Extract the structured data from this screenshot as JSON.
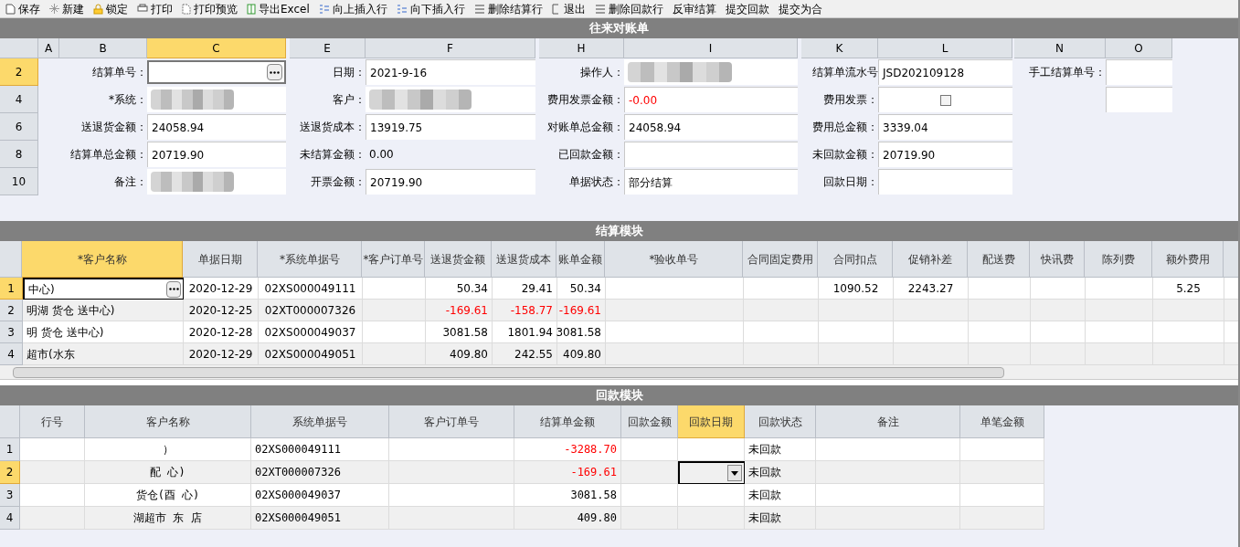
{
  "toolbar": [
    {
      "label": "保存"
    },
    {
      "label": "新建"
    },
    {
      "label": "锁定"
    },
    {
      "label": "打印"
    },
    {
      "label": "打印预览"
    },
    {
      "label": "导出Excel"
    },
    {
      "label": "向上插入行"
    },
    {
      "label": "向下插入行"
    },
    {
      "label": "删除结算行"
    },
    {
      "label": "退出"
    },
    {
      "label": "删除回款行"
    },
    {
      "label": "反审结算"
    },
    {
      "label": "提交回款"
    },
    {
      "label": "提交为合"
    }
  ],
  "statement": {
    "title": "往来对账单",
    "columns": [
      {
        "label": "A",
        "selected": false
      },
      {
        "label": "B",
        "selected": false
      },
      {
        "label": "C",
        "selected": true
      },
      {
        "label": "E",
        "selected": false
      },
      {
        "label": "F",
        "selected": false
      },
      {
        "label": "H",
        "selected": false
      },
      {
        "label": "I",
        "selected": false
      },
      {
        "label": "K",
        "selected": false
      },
      {
        "label": "L",
        "selected": false
      },
      {
        "label": "N",
        "selected": false
      },
      {
        "label": "O",
        "selected": false
      }
    ],
    "rows": [
      {
        "number": "2",
        "selected": true,
        "fields": [
          {
            "label": "结算单号：",
            "kind": "lookup",
            "selected": true
          },
          {
            "label": "日期：",
            "kind": "text",
            "value": "2021-9-16"
          },
          {
            "label": "操作人：",
            "kind": "redacted"
          },
          {
            "label": "结算单流水号",
            "kind": "text",
            "value": "JSD202109128"
          },
          {
            "label": "手工结算单号：",
            "kind": "text"
          }
        ]
      },
      {
        "number": "4",
        "selected": false,
        "fields": [
          {
            "label": "*系统：",
            "kind": "redacted"
          },
          {
            "label": "客户：",
            "kind": "redacted"
          },
          {
            "label": "费用发票金额：",
            "kind": "text",
            "value": "-0.00",
            "negative": true
          },
          {
            "label": "费用发票：",
            "kind": "checkbox",
            "checked": false
          },
          {
            "kind": "text"
          }
        ]
      },
      {
        "number": "6",
        "selected": false,
        "fields": [
          {
            "label": "送退货金额：",
            "kind": "text",
            "value": "24058.94"
          },
          {
            "label": "送退货成本：",
            "kind": "text",
            "value": "13919.75"
          },
          {
            "label": "对账单总金额：",
            "kind": "text",
            "value": "24058.94"
          },
          {
            "label": "费用总金额：",
            "kind": "text",
            "value": "3339.04"
          }
        ]
      },
      {
        "number": "8",
        "selected": false,
        "fields": [
          {
            "label": "结算单总金额：",
            "kind": "text",
            "value": "20719.90"
          },
          {
            "label": "未结算金额：",
            "kind": "plain",
            "value": "0.00"
          },
          {
            "label": "已回款金额：",
            "kind": "text"
          },
          {
            "label": "未回款金额：",
            "kind": "text",
            "value": "20719.90"
          }
        ]
      },
      {
        "number": "10",
        "selected": false,
        "fields": [
          {
            "label": "备注：",
            "kind": "redacted"
          },
          {
            "label": "开票金额：",
            "kind": "text",
            "value": "20719.90"
          },
          {
            "label": "单据状态：",
            "kind": "text",
            "value": "部分结算"
          },
          {
            "label": "回款日期：",
            "kind": "text"
          }
        ]
      }
    ]
  },
  "settlement": {
    "title": "结算模块",
    "columns": [
      {
        "label": "*客户名称",
        "selected": true
      },
      {
        "label": "单据日期",
        "selected": false
      },
      {
        "label": "*系统单据号",
        "selected": false
      },
      {
        "label": "*客户订单号",
        "selected": false
      },
      {
        "label": "送退货金额",
        "selected": false
      },
      {
        "label": "送退货成本",
        "selected": false
      },
      {
        "label": "账单金额",
        "selected": false
      },
      {
        "label": "*验收单号",
        "selected": false
      },
      {
        "label": "合同固定费用",
        "selected": false
      },
      {
        "label": "合同扣点",
        "selected": false
      },
      {
        "label": "促销补差",
        "selected": false
      },
      {
        "label": "配送费",
        "selected": false
      },
      {
        "label": "快讯费",
        "selected": false
      },
      {
        "label": "陈列费",
        "selected": false
      },
      {
        "label": "额外费用",
        "selected": false
      }
    ],
    "rows": [
      {
        "number": "1",
        "selected": true,
        "negative": false,
        "cells": [
          "中心)",
          "2020-12-29",
          "02XS000049111",
          "",
          "50.34",
          "29.41",
          "50.34",
          "",
          "",
          "1090.52",
          "2243.27",
          "",
          "",
          "",
          "5.25"
        ]
      },
      {
        "number": "2",
        "selected": false,
        "negative": true,
        "cells": [
          "明湖 货仓 送中心)",
          "2020-12-25",
          "02XT000007326",
          "",
          "-169.61",
          "-158.77",
          "-169.61",
          "",
          "",
          "",
          "",
          "",
          "",
          "",
          ""
        ]
      },
      {
        "number": "3",
        "selected": false,
        "negative": false,
        "cells": [
          "明 货仓 送中心)",
          "2020-12-28",
          "02XS000049037",
          "",
          "3081.58",
          "1801.94",
          "3081.58",
          "",
          "",
          "",
          "",
          "",
          "",
          "",
          ""
        ]
      },
      {
        "number": "4",
        "selected": false,
        "negative": false,
        "cells": [
          "超市(水东",
          "2020-12-29",
          "02XS000049051",
          "",
          "409.80",
          "242.55",
          "409.80",
          "",
          "",
          "",
          "",
          "",
          "",
          "",
          ""
        ]
      }
    ]
  },
  "payment": {
    "title": "回款模块",
    "columns": [
      {
        "label": "行号",
        "selected": false
      },
      {
        "label": "客户名称",
        "selected": false
      },
      {
        "label": "系统单据号",
        "selected": false
      },
      {
        "label": "客户订单号",
        "selected": false
      },
      {
        "label": "结算单金额",
        "selected": false
      },
      {
        "label": "回款金额",
        "selected": false
      },
      {
        "label": "回款日期",
        "selected": true
      },
      {
        "label": "回款状态",
        "selected": false
      },
      {
        "label": "备注",
        "selected": false
      },
      {
        "label": "单笔金额",
        "selected": false
      }
    ],
    "rows": [
      {
        "number": "1",
        "selected": false,
        "negative": true,
        "cells": [
          "",
          "）",
          "02XS000049111",
          "",
          "-3288.70",
          "",
          "",
          "未回款",
          "",
          ""
        ]
      },
      {
        "number": "2",
        "selected": true,
        "negative": true,
        "cells": [
          "",
          "配 心)",
          "02XT000007326",
          "",
          "-169.61",
          "",
          "",
          "未回款",
          "",
          ""
        ]
      },
      {
        "number": "3",
        "selected": false,
        "negative": false,
        "cells": [
          "",
          "货仓(酉 心)",
          "02XS000049037",
          "",
          "3081.58",
          "",
          "",
          "未回款",
          "",
          ""
        ]
      },
      {
        "number": "4",
        "selected": false,
        "negative": false,
        "cells": [
          "",
          "湖超市 东 店",
          "02XS000049051",
          "",
          "409.80",
          "",
          "",
          "未回款",
          "",
          ""
        ]
      }
    ]
  }
}
